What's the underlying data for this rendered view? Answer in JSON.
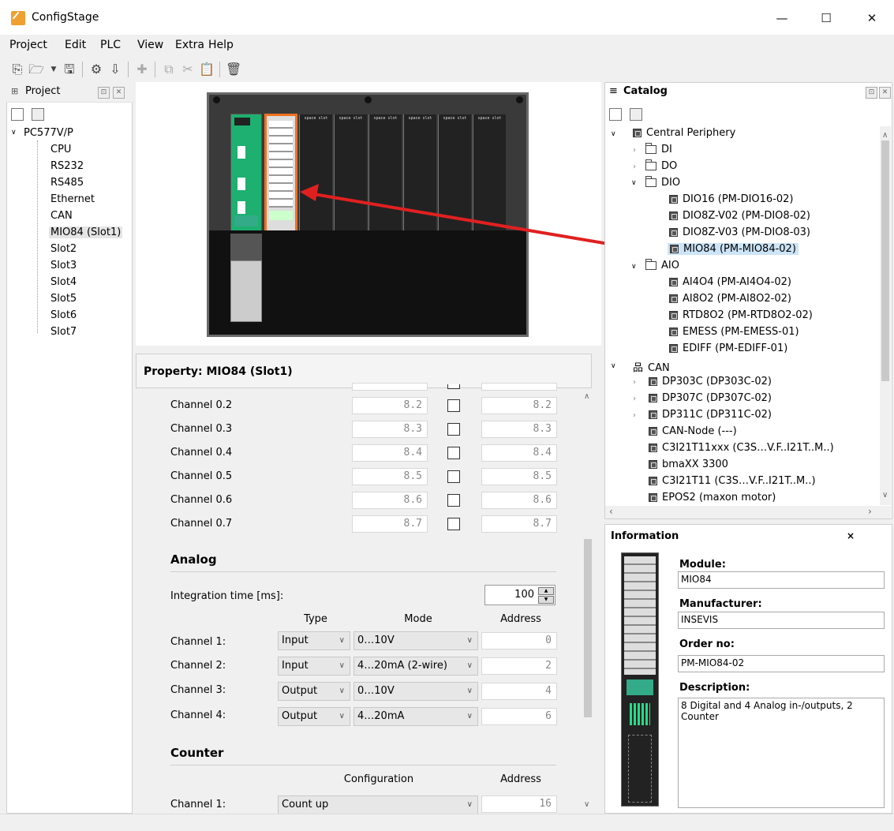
{
  "window": {
    "title": "ConfigStage",
    "minimize": "—",
    "maximize": "☐",
    "close": "✕"
  },
  "menu": {
    "project": "Project",
    "edit": "Edit",
    "plc": "PLC",
    "view": "View",
    "extra": "Extra",
    "help": "Help"
  },
  "project_panel": {
    "title": "Project",
    "root": "PC577V/P",
    "items": [
      "CPU",
      "RS232",
      "RS485",
      "Ethernet",
      "CAN",
      "MIO84 (Slot1)",
      "Slot2",
      "Slot3",
      "Slot4",
      "Slot5",
      "Slot6",
      "Slot7"
    ],
    "selected_index": 5
  },
  "plc_visual": {
    "slot_labels": [
      "space slot",
      "space slot",
      "space slot",
      "space slot",
      "space slot",
      "space slot"
    ]
  },
  "property": {
    "title": "Property: MIO84 (Slot1)",
    "digital_channels": [
      {
        "name": "Channel 0.2",
        "value1": "8.2",
        "value2": "8.2"
      },
      {
        "name": "Channel 0.3",
        "value1": "8.3",
        "value2": "8.3"
      },
      {
        "name": "Channel 0.4",
        "value1": "8.4",
        "value2": "8.4"
      },
      {
        "name": "Channel 0.5",
        "value1": "8.5",
        "value2": "8.5"
      },
      {
        "name": "Channel 0.6",
        "value1": "8.6",
        "value2": "8.6"
      },
      {
        "name": "Channel 0.7",
        "value1": "8.7",
        "value2": "8.7"
      }
    ],
    "analog": {
      "heading": "Analog",
      "integration_label": "Integration time [ms]:",
      "integration_value": "100",
      "col_type": "Type",
      "col_mode": "Mode",
      "col_address": "Address",
      "channels": [
        {
          "name": "Channel 1:",
          "type": "Input",
          "mode": "0…10V",
          "address": "0"
        },
        {
          "name": "Channel 2:",
          "type": "Input",
          "mode": "4…20mA (2-wire)",
          "address": "2"
        },
        {
          "name": "Channel 3:",
          "type": "Output",
          "mode": "0…10V",
          "address": "4"
        },
        {
          "name": "Channel 4:",
          "type": "Output",
          "mode": "4…20mA",
          "address": "6"
        }
      ]
    },
    "counter": {
      "heading": "Counter",
      "col_config": "Configuration",
      "col_address": "Address",
      "channels": [
        {
          "name": "Channel 1:",
          "config": "Count up",
          "address": "16"
        }
      ]
    }
  },
  "catalog": {
    "title": "Catalog",
    "central": "Central Periphery",
    "di": "DI",
    "do": "DO",
    "dio": "DIO",
    "dio_items": [
      "DIO16 (PM-DIO16-02)",
      "DIO8Z-V02 (PM-DIO8-02)",
      "DIO8Z-V03 (PM-DIO8-03)",
      "MIO84 (PM-MIO84-02)"
    ],
    "aio": "AIO",
    "aio_items": [
      "AI4O4 (PM-AI4O4-02)",
      "AI8O2 (PM-AI8O2-02)",
      "RTD8O2 (PM-RTD8O2-02)",
      "EMESS (PM-EMESS-01)",
      "EDIFF (PM-EDIFF-01)"
    ],
    "can": "CAN",
    "can_items": [
      "DP303C (DP303C-02)",
      "DP307C (DP307C-02)",
      "DP311C (DP311C-02)",
      "CAN-Node (---)",
      "C3I21T11xxx (C3S…V.F..I21T..M..)",
      "bmaXX 3300",
      "C3I21T11 (C3S…V.F..I21T..M..)",
      "EPOS2 (maxon motor)"
    ]
  },
  "information": {
    "title": "Information",
    "module_label": "Module:",
    "module_value": "MIO84",
    "manufacturer_label": "Manufacturer:",
    "manufacturer_value": "INSEVIS",
    "order_label": "Order no:",
    "order_value": "PM-MIO84-02",
    "description_label": "Description:",
    "description_value": "8 Digital and 4 Analog in-/outputs, 2 Counter"
  },
  "colors": {
    "accent_red": "#e02020",
    "selection": "#cce4f7",
    "module_highlight": "#f07020"
  }
}
